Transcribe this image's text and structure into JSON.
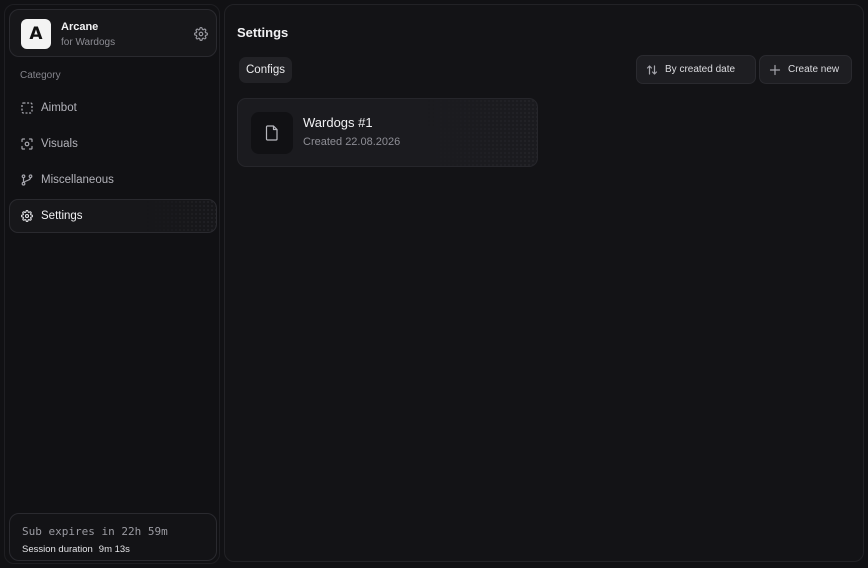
{
  "brand": {
    "logo_letter": "A",
    "name": "Arcane",
    "subtitle": "for Wardogs",
    "settings_icon": "gear-icon"
  },
  "sidebar": {
    "category_label": "Category",
    "items": [
      {
        "label": "Aimbot",
        "icon": "crosshair-square-icon",
        "active": false
      },
      {
        "label": "Visuals",
        "icon": "eye-scan-icon",
        "active": false
      },
      {
        "label": "Miscellaneous",
        "icon": "git-branch-icon",
        "active": false
      },
      {
        "label": "Settings",
        "icon": "gear-icon",
        "active": true
      }
    ]
  },
  "subscription": {
    "expires_text": "Sub expires in 22h 59m",
    "session_label": "Session duration",
    "session_value": "9m 13s"
  },
  "main": {
    "title": "Settings",
    "tab_label": "Configs",
    "sort_button_label": "By created date",
    "create_button_label": "Create new"
  },
  "configs": [
    {
      "name": "Wardogs #1",
      "created": "Created 22.08.2026",
      "icon": "file-icon"
    }
  ],
  "colors": {
    "background": "#111114",
    "panel": "#17171a",
    "border": "#2a2a2f",
    "text": "#f1f1f3",
    "muted": "#8c8c93"
  }
}
